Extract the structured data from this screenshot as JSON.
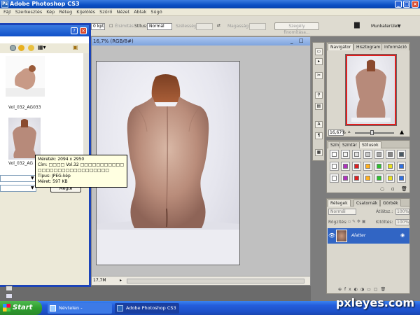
{
  "app": {
    "title": "Adobe Photoshop CS3",
    "icon": "Ps"
  },
  "menu": [
    "Fájl",
    "Szerkesztés",
    "Kép",
    "Réteg",
    "Kijelölés",
    "Szűrő",
    "Nézet",
    "Ablak",
    "Súgó"
  ],
  "options": {
    "px_value": "0 kpt",
    "antialias_label": "Élsimítás",
    "style_label": "Stílus:",
    "style_value": "Normál",
    "width_label": "Szélesség:",
    "height_label": "Magasság:",
    "refine_button": "Szegély finomítása...",
    "workspace_label": "Munkaterület"
  },
  "document": {
    "title": "16,7% (RGB/8#)",
    "zoom": "16,7%",
    "status": "17,7M"
  },
  "bridge": {
    "thumbs": [
      {
        "caption": "Vol_032_AG033"
      },
      {
        "caption": "Vol_032_AG"
      }
    ],
    "button_label": "Megte"
  },
  "tooltip": {
    "dimensions": "Méretek: 2094 x 2950",
    "title": "Cím: □□□□ Vol.32 □□□□□□□□□□□",
    "title_line2": "□□□□□□□□□□□□□□□□□□",
    "type": "Típus: JPEG-kép",
    "size": "Méret: 597 KB"
  },
  "navigator": {
    "tabs": [
      "Navigátor",
      "Hisztogram",
      "Információ"
    ],
    "zoom": "16,67%"
  },
  "swatches": {
    "tabs": [
      "Szín",
      "Színtár",
      "Stílusok"
    ],
    "row1": [
      "#ffffff",
      "#f3f3f3",
      "#e0e0e0",
      "#c8c8c8",
      "#a8a8a8",
      "#888888",
      "#4a5a66"
    ],
    "row2": [
      "#ffffff",
      "#b030c0",
      "#e02020",
      "#ffb020",
      "#30c030",
      "#e8e020",
      "#3070e0"
    ],
    "row3": [
      "#ffffff",
      "#b030c0",
      "#e02020",
      "#ffb020",
      "#30c030",
      "#e8e020",
      "#3070e0"
    ]
  },
  "layers": {
    "tabs": [
      "Rétegek",
      "Csatornák",
      "Görbék"
    ],
    "blend": "Normál",
    "opacity_label": "Átlátsz.:",
    "opacity_value": "100%",
    "lock_label": "Rögzítés:",
    "fill_label": "Kitöltés:",
    "fill_value": "100%",
    "layer_name": "Alatter"
  },
  "taskbar": {
    "start": "Start",
    "items": [
      "Névtelen - Jegyzettömb",
      "Adobe Photoshop CS3"
    ]
  },
  "watermark": "pxleyes.com"
}
